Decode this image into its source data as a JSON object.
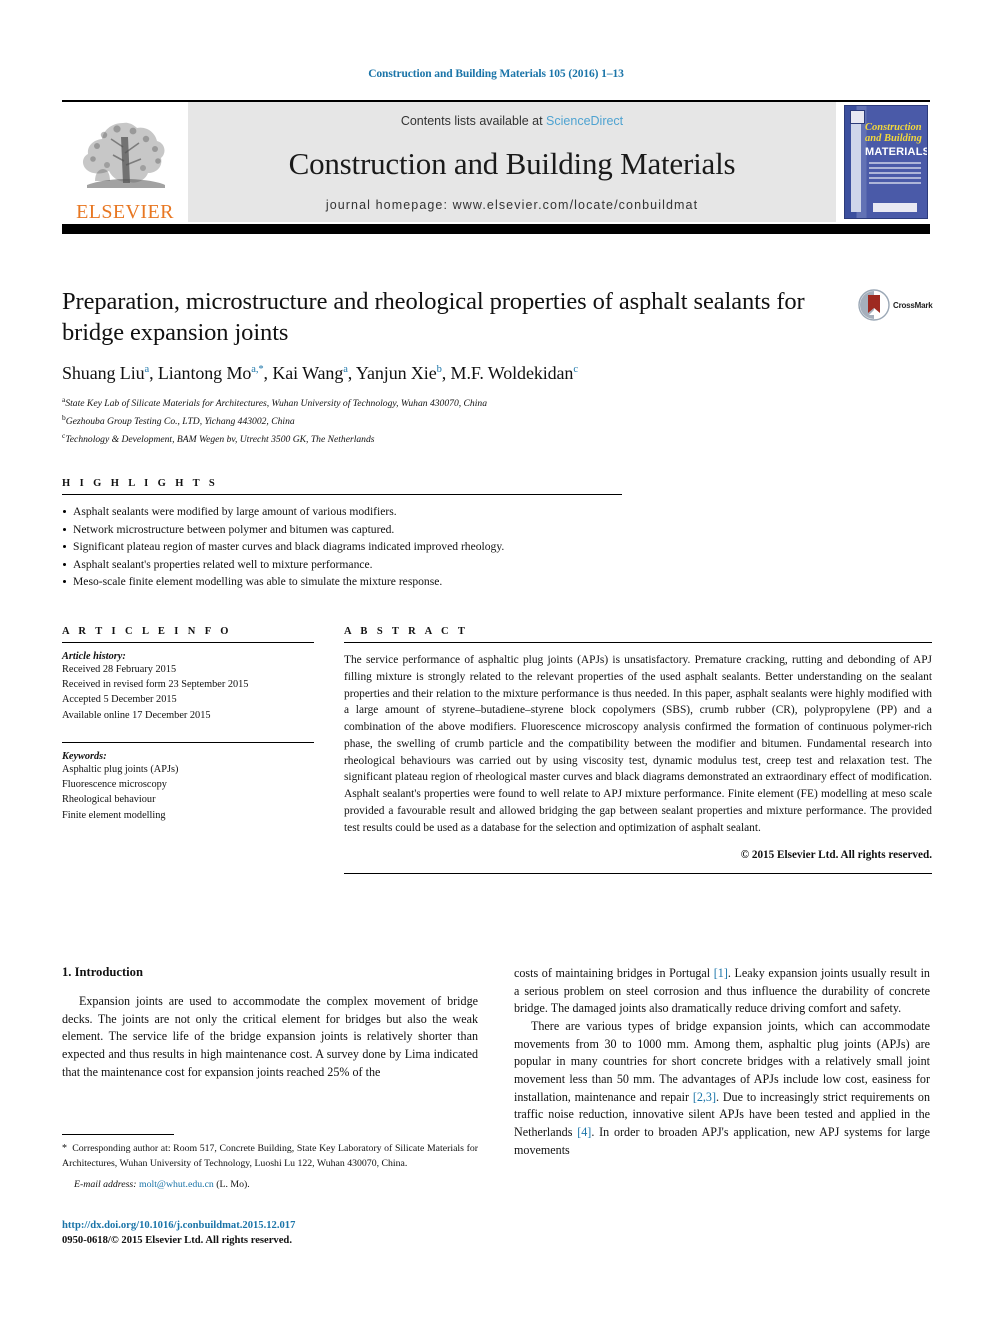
{
  "running_head": "Construction and Building Materials 105 (2016) 1–13",
  "journal_header": {
    "contents_prefix": "Contents lists available at ",
    "sciencedirect": "ScienceDirect",
    "journal_title": "Construction and Building Materials",
    "homepage": "journal homepage: www.elsevier.com/locate/conbuildmat",
    "publisher_logo_text": "ELSEVIER",
    "cover": {
      "line1": "Construction",
      "line2": "and Building",
      "line3": "MATERIALS"
    },
    "colors": {
      "link": "#4fa3d1",
      "elsevier_orange": "#E87722",
      "header_band": "#e6e6e6",
      "cover_blue": "#4a5aa8",
      "cover_yellow": "#f2d83c"
    }
  },
  "article": {
    "title": "Preparation, microstructure and rheological properties of asphalt sealants for bridge expansion joints",
    "authors_html": "Shuang Liu<sup>a</sup>, Liantong Mo<sup>a,*</sup>, Kai Wang<sup>a</sup>, Yanjun Xie<sup>b</sup>, M.F. Woldekidan<sup>c</sup>",
    "affiliations": [
      "State Key Lab of Silicate Materials for Architectures, Wuhan University of Technology, Wuhan 430070, China",
      "Gezhouba Group Testing Co., LTD, Yichang 443002, China",
      "Technology & Development, BAM Wegen bv, Utrecht 3500 GK, The Netherlands"
    ],
    "affil_marks": [
      "a",
      "b",
      "c"
    ],
    "crossmark_label": "CrossMark"
  },
  "highlights": {
    "heading": "H I G H L I G H T S",
    "items": [
      "Asphalt sealants were modified by large amount of various modifiers.",
      "Network microstructure between polymer and bitumen was captured.",
      "Significant plateau region of master curves and black diagrams indicated improved rheology.",
      "Asphalt sealant's properties related well to mixture performance.",
      "Meso-scale finite element modelling was able to simulate the mixture response."
    ]
  },
  "article_info": {
    "heading": "A R T I C L E    I N F O",
    "history_label": "Article history:",
    "history": [
      "Received 28 February 2015",
      "Received in revised form 23 September 2015",
      "Accepted 5 December 2015",
      "Available online 17 December 2015"
    ],
    "keywords_label": "Keywords:",
    "keywords": [
      "Asphaltic plug joints (APJs)",
      "Fluorescence microscopy",
      "Rheological behaviour",
      "Finite element modelling"
    ]
  },
  "abstract": {
    "heading": "A B S T R A C T",
    "text": "The service performance of asphaltic plug joints (APJs) is unsatisfactory. Premature cracking, rutting and debonding of APJ filling mixture is strongly related to the relevant properties of the used asphalt sealants. Better understanding on the sealant properties and their relation to the mixture performance is thus needed. In this paper, asphalt sealants were highly modified with a large amount of styrene–butadiene–styrene block copolymers (SBS), crumb rubber (CR), polypropylene (PP) and a combination of the above modifiers. Fluorescence microscopy analysis confirmed the formation of continuous polymer-rich phase, the swelling of crumb particle and the compatibility between the modifier and bitumen. Fundamental research into rheological behaviours was carried out by using viscosity test, dynamic modulus test, creep test and relaxation test. The significant plateau region of rheological master curves and black diagrams demonstrated an extraordinary effect of modification. Asphalt sealant's properties were found to well relate to APJ mixture performance. Finite element (FE) modelling at meso scale provided a favourable result and allowed bridging the gap between sealant properties and mixture performance. The provided test results could be used as a database for the selection and optimization of asphalt sealant.",
    "copyright": "© 2015 Elsevier Ltd. All rights reserved."
  },
  "body": {
    "section_heading": "1. Introduction",
    "left_paragraph": "Expansion joints are used to accommodate the complex movement of bridge decks. The joints are not only the critical element for bridges but also the weak element. The service life of the bridge expansion joints is relatively shorter than expected and thus results in high maintenance cost. A survey done by Lima indicated that the maintenance cost for expansion joints reached 25% of the",
    "right_paragraph_1_html": "costs of maintaining bridges in Portugal <span class=\"ref\">[1]</span>. Leaky expansion joints usually result in a serious problem on steel corrosion and thus influence the durability of concrete bridge. The damaged joints also dramatically reduce driving comfort and safety.",
    "right_paragraph_2_html": "There are various types of bridge expansion joints, which can accommodate movements from 30 to 1000 mm. Among them, asphaltic plug joints (APJs) are popular in many countries for short concrete bridges with a relatively small joint movement less than 50 mm. The advantages of APJs include low cost, easiness for installation, maintenance and repair <span class=\"ref\">[2,3]</span>. Due to increasingly strict requirements on traffic noise reduction, innovative silent APJs have been tested and applied in the Netherlands <span class=\"ref\">[4]</span>. In order to broaden APJ's application, new APJ systems for large movements"
  },
  "footnote": {
    "corresponding_html": "<span class=\"star\">*</span>&nbsp; Corresponding author at: Room 517, Concrete Building, State Key Laboratory of Silicate Materials for Architectures, Wuhan University of Technology, Luoshi Lu 122, Wuhan 430070, China.",
    "email_html": "<i>E-mail address:</i> <span class=\"email-link\">molt@whut.edu.cn</span> (L. Mo)."
  },
  "imprint": {
    "doi": "http://dx.doi.org/10.1016/j.conbuildmat.2015.12.017",
    "issn": "0950-0618/© 2015 Elsevier Ltd. All rights reserved."
  }
}
